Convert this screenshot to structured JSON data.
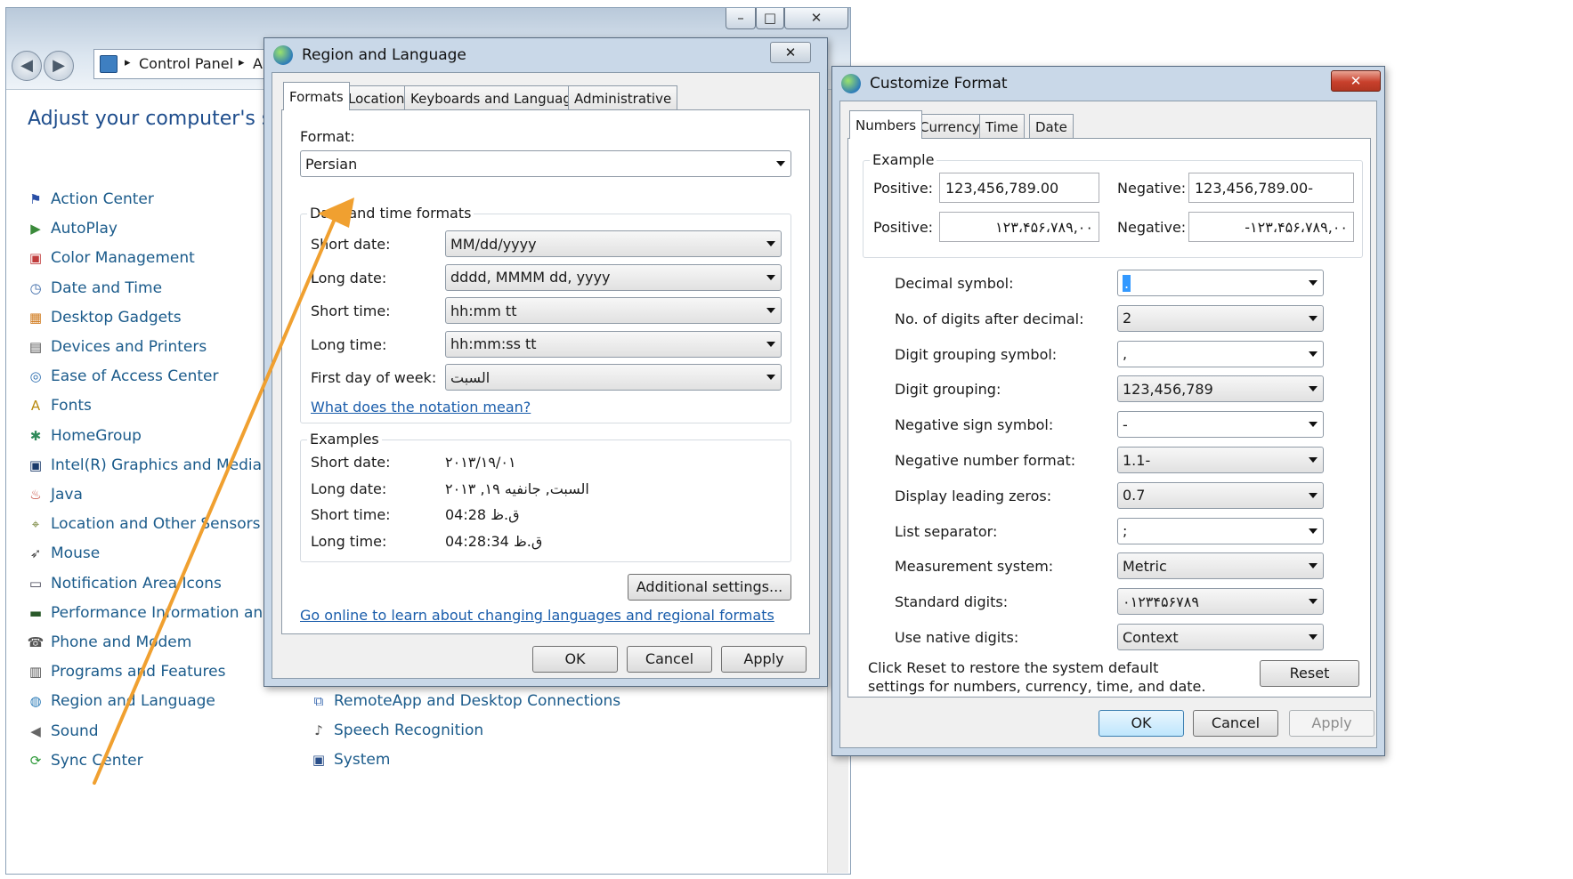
{
  "control_panel": {
    "breadcrumb": [
      "Control Panel",
      "Al"
    ],
    "heading": "Adjust your computer's settin",
    "items_left": [
      {
        "label": "Action Center",
        "icon": "flag-icon"
      },
      {
        "label": "AutoPlay",
        "icon": "autoplay-icon"
      },
      {
        "label": "Color Management",
        "icon": "monitor-color-icon"
      },
      {
        "label": "Date and Time",
        "icon": "calendar-clock-icon"
      },
      {
        "label": "Desktop Gadgets",
        "icon": "gadgets-icon"
      },
      {
        "label": "Devices and Printers",
        "icon": "printer-icon"
      },
      {
        "label": "Ease of Access Center",
        "icon": "ease-of-access-icon"
      },
      {
        "label": "Fonts",
        "icon": "fonts-icon"
      },
      {
        "label": "HomeGroup",
        "icon": "homegroup-icon"
      },
      {
        "label": "Intel(R) Graphics and Media",
        "icon": "intel-graphics-icon"
      },
      {
        "label": "Java",
        "icon": "java-icon"
      },
      {
        "label": "Location and Other Sensors",
        "icon": "location-sensors-icon"
      },
      {
        "label": "Mouse",
        "icon": "mouse-icon"
      },
      {
        "label": "Notification Area Icons",
        "icon": "notification-icon"
      },
      {
        "label": "Performance Information and Tool",
        "icon": "performance-icon"
      },
      {
        "label": "Phone and Modem",
        "icon": "phone-modem-icon"
      },
      {
        "label": "Programs and Features",
        "icon": "programs-icon"
      },
      {
        "label": "Region and Language",
        "icon": "globe-icon"
      },
      {
        "label": "Sound",
        "icon": "speaker-icon"
      },
      {
        "label": "Sync Center",
        "icon": "sync-icon"
      }
    ],
    "items_right": [
      {
        "label": "RemoteApp and Desktop Connections",
        "icon": "remoteapp-icon"
      },
      {
        "label": "Speech Recognition",
        "icon": "microphone-icon"
      },
      {
        "label": "System",
        "icon": "system-icon"
      }
    ]
  },
  "region_dialog": {
    "title": "Region and Language",
    "close_glyph": "✕",
    "tabs": [
      "Formats",
      "Location",
      "Keyboards and Languages",
      "Administrative"
    ],
    "format_label": "Format:",
    "format_value": "Persian",
    "dt_group_label": "Date and time formats",
    "fields": [
      {
        "label": "Short date:",
        "value": "MM/dd/yyyy"
      },
      {
        "label": "Long date:",
        "value": "dddd, MMMM dd, yyyy"
      },
      {
        "label": "Short time:",
        "value": "hh:mm tt"
      },
      {
        "label": "Long time:",
        "value": "hh:mm:ss tt"
      },
      {
        "label": "First day of week:",
        "value": "السبت"
      }
    ],
    "notation_link": "What does the notation mean?",
    "examples_label": "Examples",
    "examples": [
      {
        "label": "Short date:",
        "value": "۲۰۱۳/۱۹/۰۱"
      },
      {
        "label": "Long date:",
        "value": "السبت, جانفيه ۱۹, ۲۰۱۳"
      },
      {
        "label": "Short time:",
        "value": "04:28 ق.ظ"
      },
      {
        "label": "Long time:",
        "value": "04:28:34 ق.ظ"
      }
    ],
    "additional_button": "Additional settings...",
    "online_link": "Go online to learn about changing languages and regional formats",
    "ok": "OK",
    "cancel": "Cancel",
    "apply": "Apply"
  },
  "customize_dialog": {
    "title": "Customize Format",
    "close_glyph": "✕",
    "tabs": [
      "Numbers",
      "Currency",
      "Time",
      "Date"
    ],
    "example_label": "Example",
    "positive_label": "Positive:",
    "negative_label": "Negative:",
    "positive_1": "123,456,789.00",
    "negative_1": "123,456,789.00-",
    "positive_2": "۱۲۳،۴۵۶،۷۸۹,۰۰",
    "negative_2": "-۱۲۳،۴۵۶،۷۸۹,۰۰",
    "settings": [
      {
        "label": "Decimal symbol:",
        "value": "."
      },
      {
        "label": "No. of digits after decimal:",
        "value": "2"
      },
      {
        "label": "Digit grouping symbol:",
        "value": ","
      },
      {
        "label": "Digit grouping:",
        "value": "123,456,789"
      },
      {
        "label": "Negative sign symbol:",
        "value": "-"
      },
      {
        "label": "Negative number format:",
        "value": "1.1-"
      },
      {
        "label": "Display leading zeros:",
        "value": "0.7"
      },
      {
        "label": "List separator:",
        "value": ";"
      },
      {
        "label": "Measurement system:",
        "value": "Metric"
      },
      {
        "label": "Standard digits:",
        "value": "۰۱۲۳۴۵۶۷۸۹"
      },
      {
        "label": "Use native digits:",
        "value": "Context"
      }
    ],
    "reset_text": "Click Reset to restore the system default settings for numbers, currency, time, and date.",
    "reset": "Reset",
    "ok": "OK",
    "cancel": "Cancel",
    "apply": "Apply"
  },
  "colors": {
    "link": "#1b5b8b",
    "heading": "#1e4d8c",
    "arrow": "#f0a030",
    "close_red": "#c8402c"
  }
}
